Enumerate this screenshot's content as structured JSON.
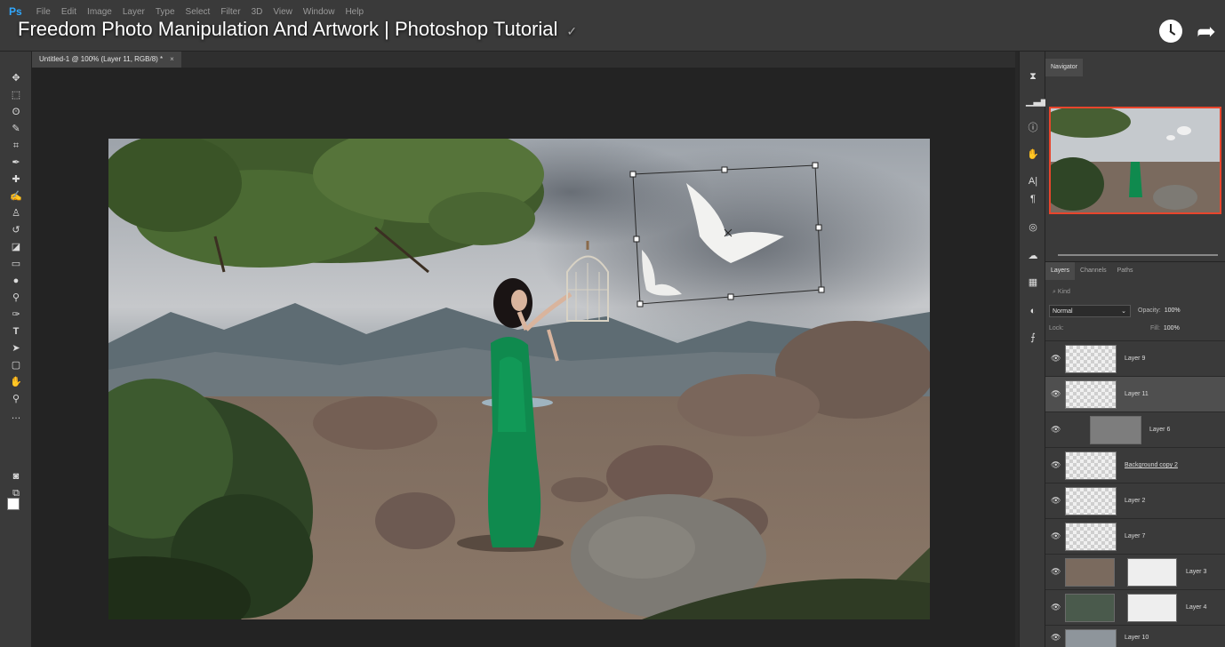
{
  "app": {
    "logo": "Ps"
  },
  "menu": {
    "items": [
      "File",
      "Edit",
      "Image",
      "Layer",
      "Type",
      "Select",
      "Filter",
      "3D",
      "View",
      "Window",
      "Help"
    ]
  },
  "video": {
    "title": "Freedom Photo Manipulation And Artwork | Photoshop Tutorial",
    "clock_icon": "clock-icon",
    "share_icon": "share-icon"
  },
  "document_tab": {
    "label": "Untitled-1 @ 100% (Layer 11, RGB/8) *",
    "close": "×"
  },
  "tools": [
    "move-icon",
    "marquee-icon",
    "lasso-icon",
    "quick-select-icon",
    "crop-icon",
    "eyedropper-icon",
    "healing-icon",
    "brush-icon",
    "stamp-icon",
    "history-brush-icon",
    "eraser-icon",
    "gradient-icon",
    "blur-icon",
    "dodge-icon",
    "pen-icon",
    "type-icon",
    "path-select-icon",
    "rectangle-icon",
    "hand-icon",
    "zoom-icon",
    "more-tools-icon"
  ],
  "colors": {
    "foreground": "#ffffff",
    "background": "#f39b12",
    "selection_outline": "#e8452c",
    "accent": "#31a8ff"
  },
  "navigator": {
    "tab": "Navigator"
  },
  "layers_panel": {
    "tabs": [
      "Layers",
      "Channels",
      "Paths"
    ],
    "filter_kind": "Kind",
    "blend_mode": "Normal",
    "opacity_label": "Opacity:",
    "opacity_value": "100%",
    "lock_label": "Lock:",
    "fill_label": "Fill:",
    "fill_value": "100%",
    "layers": [
      {
        "name": "Layer 9",
        "selected": false
      },
      {
        "name": "Layer 11",
        "selected": true
      },
      {
        "name": "Layer 6",
        "selected": false
      },
      {
        "name": "Background copy 2",
        "selected": false
      },
      {
        "name": "Layer 2",
        "selected": false
      },
      {
        "name": "Layer 7",
        "selected": false
      },
      {
        "name": "Layer 3",
        "selected": false
      },
      {
        "name": "Layer 4",
        "selected": false
      },
      {
        "name": "Layer 10",
        "selected": false
      }
    ]
  }
}
